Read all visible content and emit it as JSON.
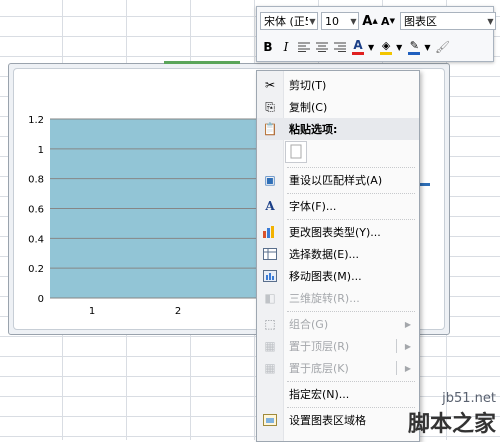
{
  "mini_toolbar": {
    "font_name": "宋体 (正5",
    "font_size": "10",
    "grow_font": "A",
    "shrink_font": "A",
    "element_selector": "图表区",
    "bold": "B",
    "italic": "I",
    "font_color_letter": "A",
    "colors": {
      "font": "#e02020",
      "fill": "#f2c500",
      "line": "#1f5fbf"
    }
  },
  "context_menu": {
    "items": [
      {
        "label": "剪切(T)",
        "icon": "scissors-icon",
        "enabled": true
      },
      {
        "label": "复制(C)",
        "icon": "copy-icon",
        "enabled": true
      },
      {
        "label": "粘贴选项:",
        "icon": "paste-icon",
        "enabled": true,
        "header": true
      },
      {
        "label": "重设以匹配样式(A)",
        "icon": "reset-style-icon",
        "enabled": true
      },
      {
        "label": "字体(F)...",
        "icon": "font-icon",
        "enabled": true
      },
      {
        "label": "更改图表类型(Y)...",
        "icon": "chart-type-icon",
        "enabled": true
      },
      {
        "label": "选择数据(E)...",
        "icon": "select-data-icon",
        "enabled": true
      },
      {
        "label": "移动图表(M)...",
        "icon": "move-chart-icon",
        "enabled": true
      },
      {
        "label": "三维旋转(R)...",
        "icon": "rotate-3d-icon",
        "enabled": false
      },
      {
        "label": "组合(G)",
        "icon": "group-icon",
        "enabled": false,
        "submenu": true
      },
      {
        "label": "置于顶层(R)",
        "icon": "bring-front-icon",
        "enabled": false,
        "submenu": true
      },
      {
        "label": "置于底层(K)",
        "icon": "send-back-icon",
        "enabled": false,
        "submenu": true
      },
      {
        "label": "指定宏(N)...",
        "icon": "macro-icon",
        "enabled": true
      },
      {
        "label": "设置图表区域格",
        "icon": "format-chart-area-icon",
        "enabled": true
      }
    ]
  },
  "chart_data": {
    "type": "area",
    "categories": [
      "1",
      "2"
    ],
    "values": [
      1.2,
      1.2
    ],
    "y_ticks": [
      "0",
      "0.2",
      "0.4",
      "0.6",
      "0.8",
      "1",
      "1.2"
    ],
    "ylim": [
      0,
      1.2
    ],
    "grid": true,
    "fill_color": "#92c5d6",
    "title": "",
    "xlabel": "",
    "ylabel": ""
  },
  "watermark": {
    "line1": "jb51.net",
    "line2": "脚本之家"
  }
}
